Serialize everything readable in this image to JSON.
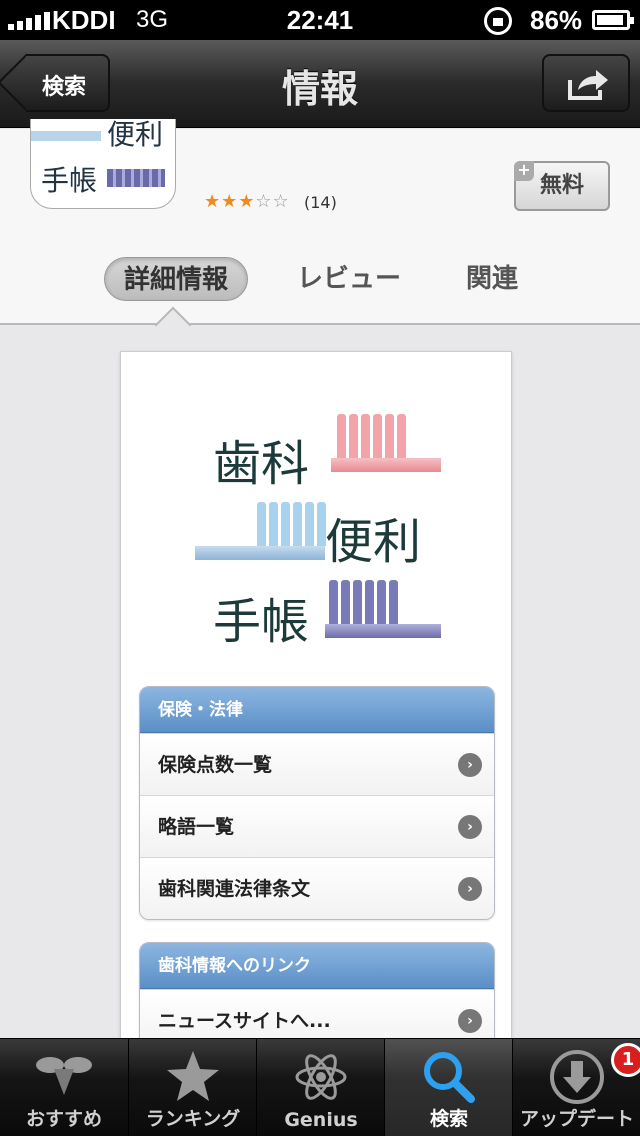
{
  "status_bar": {
    "carrier": "KDDI",
    "network": "3G",
    "time": "22:41",
    "battery": "86%"
  },
  "nav": {
    "back_label": "検索",
    "title": "情報"
  },
  "app": {
    "icon_text_1": "便利",
    "icon_text_2": "手帳",
    "rating_filled": "★★★",
    "rating_empty": "☆☆",
    "rating_value": 3,
    "rating_max": 5,
    "review_count": "(14)",
    "price": "無料",
    "price_plus": "+"
  },
  "tabs": {
    "details": "詳細情報",
    "reviews": "レビュー",
    "related": "関連"
  },
  "screenshot_logo": {
    "line1": "歯科",
    "line2": "便利",
    "line3": "手帳"
  },
  "groups": [
    {
      "header": "保険・法律",
      "items": [
        "保険点数一覧",
        "略語一覧",
        "歯科関連法律条文"
      ]
    },
    {
      "header": "歯科情報へのリンク",
      "items": [
        "ニュースサイトへ..."
      ]
    }
  ],
  "tab_bar": {
    "featured": "おすすめ",
    "ranking": "ランキング",
    "genius": "Genius",
    "search": "検索",
    "updates": "アップデート",
    "updates_badge": "1"
  },
  "colors": {
    "accent_blue": "#5a8fc8",
    "star_orange": "#f08a1c",
    "badge_red": "#d81e1e"
  }
}
